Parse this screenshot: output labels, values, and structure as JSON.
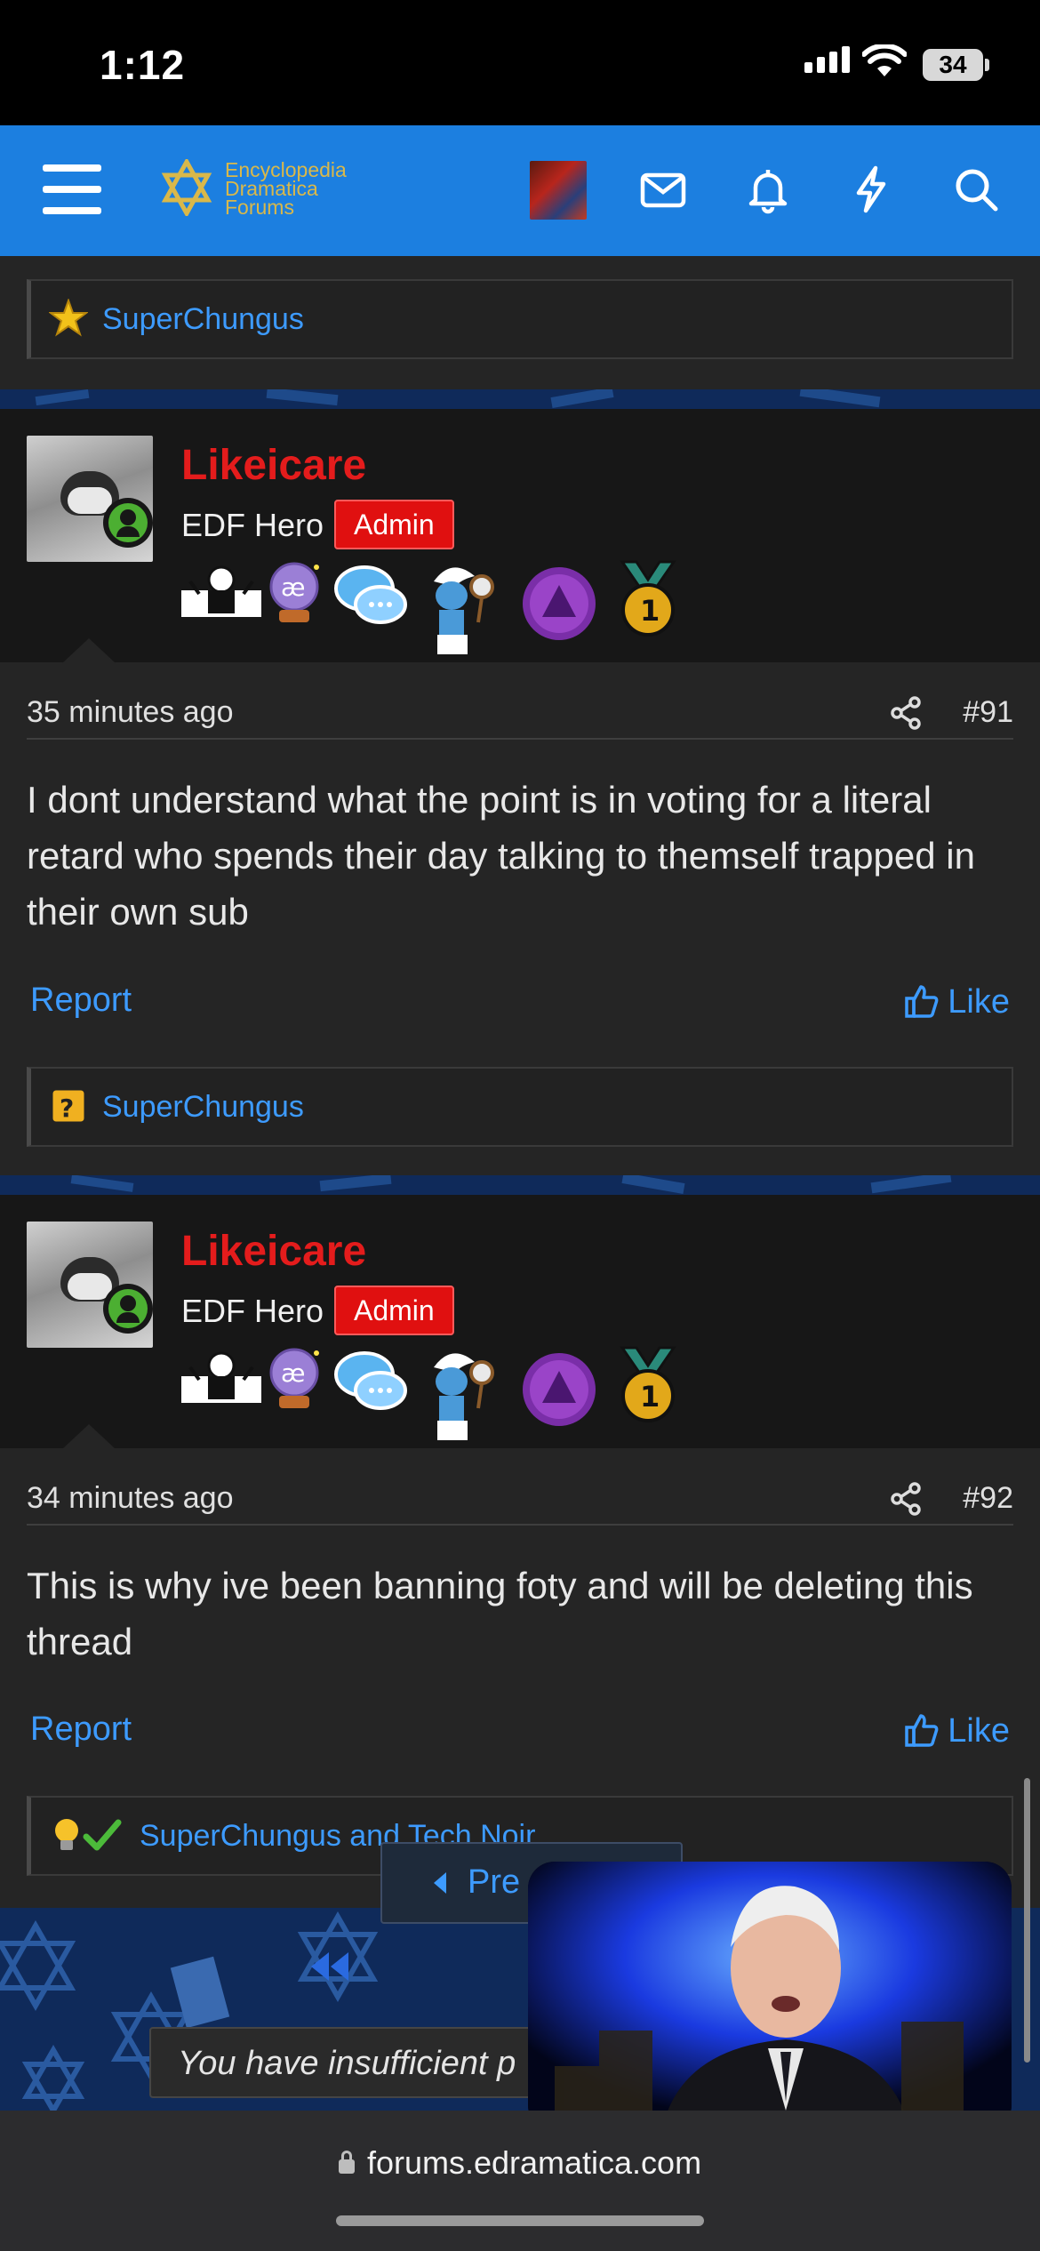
{
  "status": {
    "time": "1:12",
    "battery": "34"
  },
  "nav": {
    "logo_lines": [
      "Encyclopedia",
      "Dramatica",
      "Forums"
    ],
    "icons": [
      "menu-icon",
      "inbox-icon",
      "bell-icon",
      "bolt-icon",
      "search-icon"
    ]
  },
  "top_reactions": {
    "text": "SuperChungus",
    "icon": "star-icon"
  },
  "posts": [
    {
      "username": "Likeicare",
      "user_title": "EDF Hero",
      "badge": "Admin",
      "time_ago": "35 minutes ago",
      "post_number": "#91",
      "content": "I dont understand what the point is in voting for a literal retard who spends their day talking to themself trapped in their own sub",
      "report_label": "Report",
      "like_label": "Like",
      "reactions": "SuperChungus",
      "reaction_icon": "question-block-icon"
    },
    {
      "username": "Likeicare",
      "user_title": "EDF Hero",
      "badge": "Admin",
      "time_ago": "34 minutes ago",
      "post_number": "#92",
      "content": "This is why ive been banning foty and will be deleting this thread",
      "report_label": "Report",
      "like_label": "Like",
      "reactions": "SuperChungus and Tech Noir",
      "reaction_icon": "lightbulb-check-icon"
    }
  ],
  "pagination": {
    "prev_label": "Pre"
  },
  "notice": {
    "text": "You have insufficient p"
  },
  "browser": {
    "url": "forums.edramatica.com"
  },
  "colors": {
    "nav": "#1c7fe0",
    "link": "#3d9bff",
    "username": "#e41c1c",
    "admin_badge": "#e01010"
  }
}
